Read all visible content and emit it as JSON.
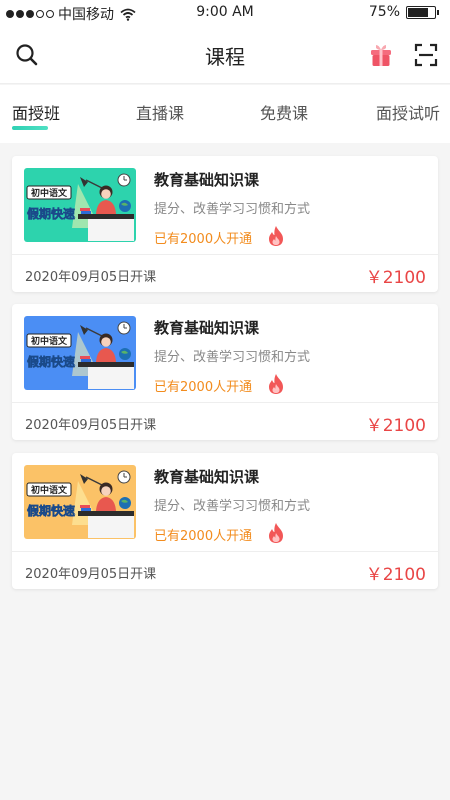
{
  "status_bar": {
    "carrier": "中国移动",
    "time": "9:00 AM",
    "battery_percent": "75%",
    "battery_level": 0.75
  },
  "nav": {
    "title": "课程",
    "left_icon": "search-icon",
    "right_icons": [
      "gift-icon",
      "scan-icon"
    ]
  },
  "tabs": [
    {
      "label": "面授班",
      "active": true
    },
    {
      "label": "直播课",
      "active": false
    },
    {
      "label": "免费课",
      "active": false
    },
    {
      "label": "面授试听",
      "active": false
    }
  ],
  "thumbnail_text": {
    "badge": "初中语文",
    "banner": "假期快速"
  },
  "courses": [
    {
      "title": "教育基础知识课",
      "description": "提分、改善学习习惯和方式",
      "enrolled": "已有2000人开通",
      "start_date": "2020年09月05日开课",
      "price": "￥2100",
      "thumb_color": "#2dd3ad"
    },
    {
      "title": "教育基础知识课",
      "description": "提分、改善学习习惯和方式",
      "enrolled": "已有2000人开通",
      "start_date": "2020年09月05日开课",
      "price": "￥2100",
      "thumb_color": "#4b8ef4"
    },
    {
      "title": "教育基础知识课",
      "description": "提分、改善学习习惯和方式",
      "enrolled": "已有2000人开通",
      "start_date": "2020年09月05日开课",
      "price": "￥2100",
      "thumb_color": "#fbc267"
    }
  ],
  "colors": {
    "accent": "#2fd1b4",
    "price": "#e94646",
    "enrolled": "#f28c1e"
  }
}
